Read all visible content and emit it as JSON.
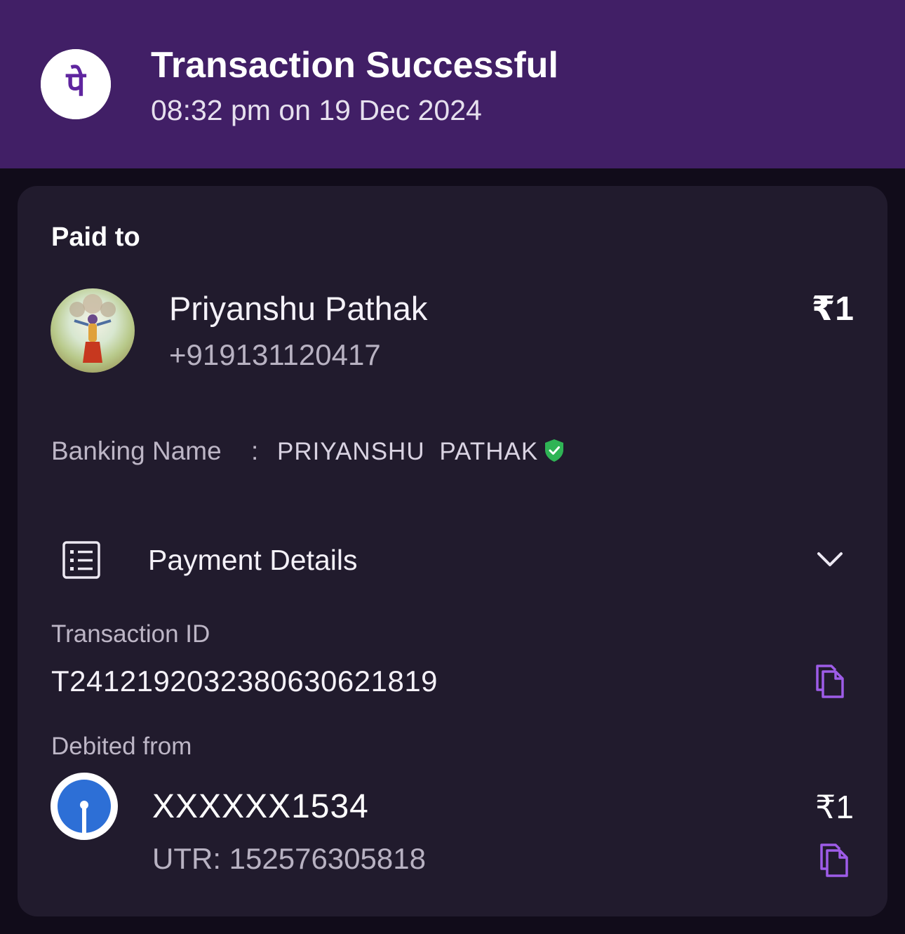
{
  "header": {
    "title": "Transaction Successful",
    "datetime": "08:32 pm on 19 Dec 2024",
    "logo_glyph": "पे",
    "background_color": "#411f66",
    "logo_color": "#5f259f"
  },
  "paid_to": {
    "label": "Paid to",
    "name": "Priyanshu Pathak",
    "phone": "+919131120417",
    "amount": "₹1",
    "banking_name_label": "Banking Name",
    "separator": ":",
    "banking_name": "PRIYANSHU  PATHAK",
    "verified_icon": "shield-check-icon",
    "verified_color": "#2fb455"
  },
  "payment_details": {
    "label": "Payment Details",
    "icon": "receipt-list-icon",
    "toggle_icon": "chevron-down-icon",
    "transaction_id_label": "Transaction ID",
    "transaction_id": "T2412192032380630621819",
    "copy_icon": "copy-icon",
    "accent_color": "#9e5ce8"
  },
  "debited_from": {
    "label": "Debited from",
    "account": "XXXXXX1534",
    "amount": "₹1",
    "utr": "UTR: 152576305818",
    "bank_logo_color": "#2d6fd6"
  }
}
